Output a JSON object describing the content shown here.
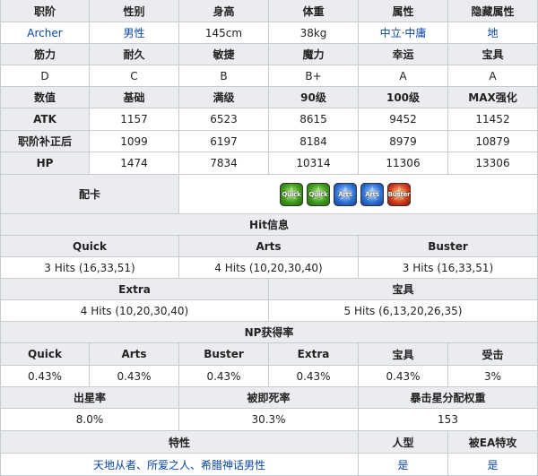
{
  "basic": {
    "headers": [
      "职阶",
      "性别",
      "身高",
      "体重",
      "属性",
      "隐藏属性"
    ],
    "values": [
      "Archer",
      "男性",
      "145cm",
      "38kg",
      "中立·中庸",
      "地"
    ]
  },
  "params": {
    "headers": [
      "筋力",
      "耐久",
      "敏捷",
      "魔力",
      "幸运",
      "宝具"
    ],
    "values": [
      "D",
      "C",
      "B",
      "B+",
      "A",
      "A"
    ]
  },
  "stats": {
    "headers": [
      "数值",
      "基础",
      "满级",
      "90级",
      "100级",
      "MAX强化"
    ],
    "rows": [
      {
        "label": "ATK",
        "values": [
          "1157",
          "6523",
          "8615",
          "9452",
          "11452"
        ]
      },
      {
        "label": "职阶补正后",
        "values": [
          "1099",
          "6197",
          "8184",
          "8979",
          "10879"
        ]
      },
      {
        "label": "HP",
        "values": [
          "1474",
          "7834",
          "10314",
          "11306",
          "13306"
        ]
      }
    ]
  },
  "deck": {
    "label": "配卡",
    "cards": [
      {
        "type": "quick",
        "text": "Quick"
      },
      {
        "type": "quick",
        "text": "Quick"
      },
      {
        "type": "arts",
        "text": "Arts"
      },
      {
        "type": "arts",
        "text": "Arts"
      },
      {
        "type": "buster",
        "text": "Buster"
      }
    ]
  },
  "hits": {
    "title": "Hit信息",
    "headers": [
      "Quick",
      "Arts",
      "Buster"
    ],
    "values": [
      "3 Hits (16,33,51)",
      "4 Hits (10,20,30,40)",
      "3 Hits (16,33,51)"
    ],
    "headers2": [
      "Extra",
      "宝具"
    ],
    "values2": [
      "4 Hits (10,20,30,40)",
      "5 Hits (6,13,20,26,35)"
    ]
  },
  "np": {
    "title": "NP获得率",
    "headers": [
      "Quick",
      "Arts",
      "Buster",
      "Extra",
      "宝具",
      "受击"
    ],
    "values": [
      "0.43%",
      "0.43%",
      "0.43%",
      "0.43%",
      "0.43%",
      "3%"
    ]
  },
  "stars": {
    "headers": [
      "出星率",
      "被即死率",
      "暴击星分配权重"
    ],
    "values": [
      "8.0%",
      "30.3%",
      "153"
    ]
  },
  "traits": {
    "headers": [
      "特性",
      "人型",
      "被EA特攻"
    ],
    "values": [
      "天地从者、所爱之人、希腊神话男性",
      "是",
      "是"
    ]
  },
  "colors": {
    "link": "#0645ad",
    "header_bg": "#eaecf0",
    "border": "#c8ccd1"
  }
}
